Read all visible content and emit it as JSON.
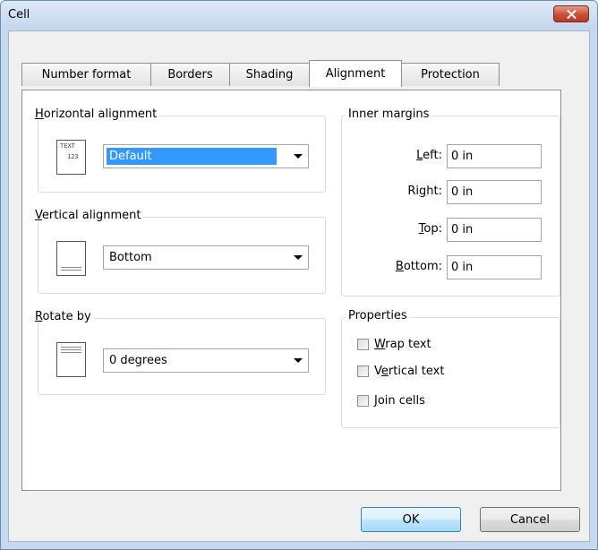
{
  "window": {
    "title": "Cell"
  },
  "tabs": [
    {
      "label": "Number format"
    },
    {
      "label": "Borders"
    },
    {
      "label": "Shading"
    },
    {
      "label": "Alignment",
      "active": true
    },
    {
      "label": "Protection"
    }
  ],
  "horizontal_alignment": {
    "legend_key": "H",
    "legend_rest": "orizontal alignment",
    "icon_text_top": "TEXT",
    "icon_text_bottom": "123",
    "value": "Default"
  },
  "vertical_alignment": {
    "legend_key": "V",
    "legend_rest": "ertical alignment",
    "value": "Bottom"
  },
  "rotate": {
    "legend_key": "R",
    "legend_rest": "otate by",
    "value": "0 degrees"
  },
  "inner_margins": {
    "legend": "Inner margins",
    "left": {
      "key": "L",
      "rest": "eft:",
      "value": "0 in"
    },
    "right": {
      "before": "Ri",
      "key": "g",
      "rest": "ht:",
      "value": "0 in"
    },
    "top": {
      "key": "T",
      "rest": "op:",
      "value": "0 in"
    },
    "bottom": {
      "key": "B",
      "rest": "ottom:",
      "value": "0 in"
    }
  },
  "properties": {
    "legend": "Properties",
    "wrap": {
      "key": "W",
      "rest": "rap text",
      "checked": false
    },
    "vertical": {
      "before": "V",
      "key": "e",
      "rest": "rtical text",
      "checked": false
    },
    "join": {
      "key": "J",
      "rest": "oin cells",
      "checked": false
    }
  },
  "buttons": {
    "ok": "OK",
    "cancel": "Cancel"
  },
  "colors": {
    "title_bar": "#c4d6ec",
    "close": "#c8503a",
    "selection": "#3399ff",
    "default_button": "#3c7fb1"
  }
}
